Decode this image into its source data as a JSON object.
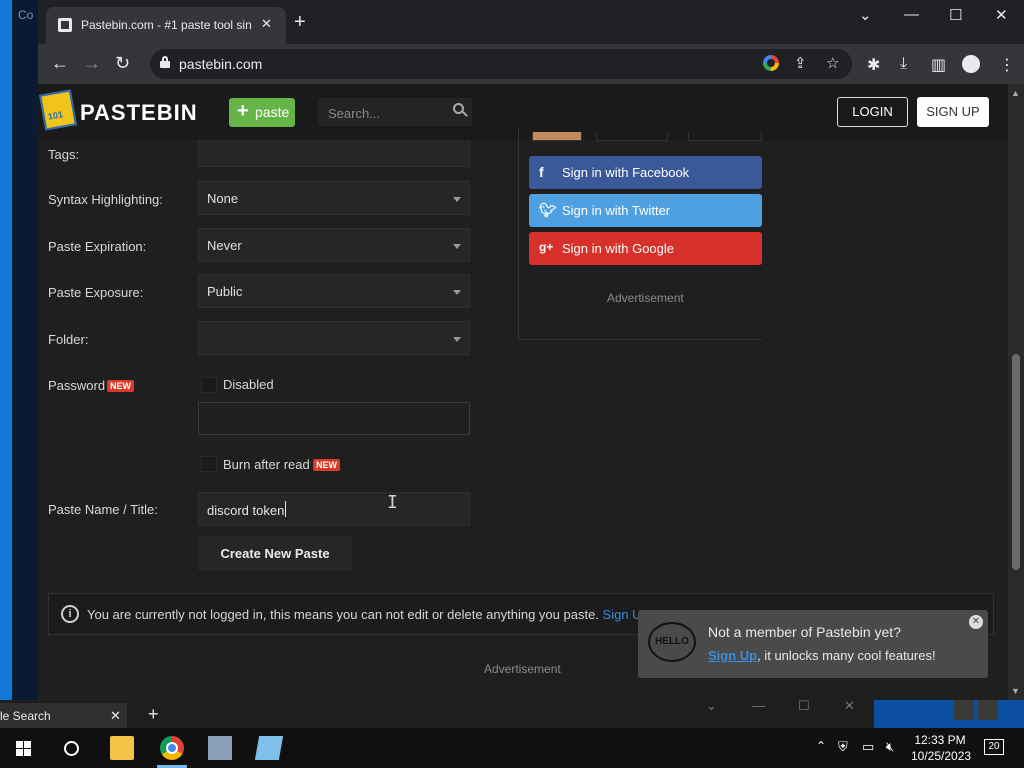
{
  "desktop": {
    "left_partial": "Co"
  },
  "browser": {
    "tab_title": "Pastebin.com - #1 paste tool sin",
    "tab_close": "✕",
    "new_tab": "+",
    "window_controls": {
      "collapse": "⌄",
      "minimize": "—",
      "maximize": "☐",
      "close": "✕"
    },
    "nav": {
      "back": "←",
      "forward": "→",
      "reload": "↻"
    },
    "url": "pastebin.com",
    "icons": [
      "google-icon",
      "share-icon",
      "star-icon",
      "extensions-icon",
      "download-icon",
      "sidebar-icon",
      "profile-icon",
      "menu-icon"
    ]
  },
  "header": {
    "logo": "PASTEBIN",
    "paste_button": "paste",
    "search_placeholder": "Search...",
    "login": "LOGIN",
    "signup": "SIGN UP"
  },
  "form": {
    "tags_label": "Tags:",
    "syntax_label": "Syntax Highlighting:",
    "syntax_value": "None",
    "expiration_label": "Paste Expiration:",
    "expiration_value": "Never",
    "exposure_label": "Paste Exposure:",
    "exposure_value": "Public",
    "folder_label": "Folder:",
    "folder_value": "",
    "password_label": "Password",
    "new_badge": "NEW",
    "password_checkbox": "Disabled",
    "burn_checkbox": "Burn after read",
    "title_label": "Paste Name / Title:",
    "title_value": "discord token",
    "create_button": "Create New Paste"
  },
  "sidebar": {
    "facebook": "Sign in with Facebook",
    "twitter": "Sign in with Twitter",
    "google": "Sign in with Google",
    "advertisement": "Advertisement"
  },
  "info": {
    "text": "You are currently not logged in, this means you can not edit or delete anything you paste.",
    "link": "Sign Up"
  },
  "bottom_ad": "Advertisement",
  "toast": {
    "line1": "Not a member of Pastebin yet?",
    "link": "Sign Up",
    "line2_rest": ", it unlocks many cool features!",
    "hello": "HELLO"
  },
  "bg_window": {
    "tab_text": "le Search",
    "tab_close": "✕",
    "new_tab": "+"
  },
  "taskbar": {
    "time": "12:33 PM",
    "date": "10/25/2023",
    "notifications": "20"
  },
  "colors": {
    "accent_green": "#66b447",
    "facebook": "#3b5998",
    "twitter": "#4fa0e0",
    "google": "#d7312c",
    "link_blue": "#3a8ed8",
    "badge_red": "#d83a2a"
  }
}
